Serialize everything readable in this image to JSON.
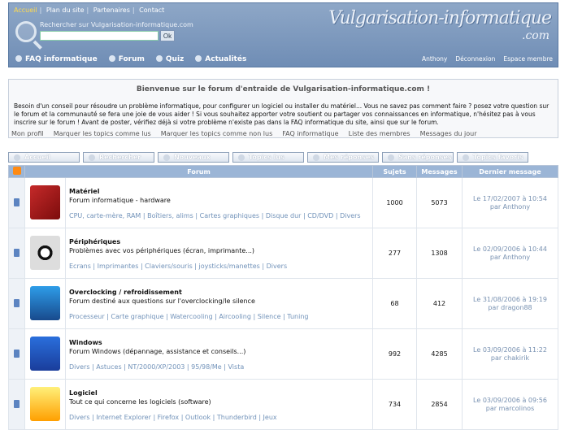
{
  "topnav": {
    "home": "Accueil",
    "sitemap": "Plan du site",
    "partners": "Partenaires",
    "contact": "Contact"
  },
  "search": {
    "label": "Rechercher sur Vulgarisation-informatique.com",
    "value": "",
    "button": "Ok"
  },
  "logo": {
    "main": "Vulgarisation-informatique",
    ".com": ".com"
  },
  "header_nav": [
    "FAQ informatique",
    "Forum",
    "Quiz",
    "Actualités"
  ],
  "user_nav": [
    "Anthony",
    "Déconnexion",
    "Espace membre"
  ],
  "welcome": {
    "title": "Bienvenue sur le forum d'entraide de Vulgarisation-informatique.com !",
    "text": "Besoin d'un conseil pour résoudre un problème informatique, pour configurer un logiciel ou installer du matériel... Vous ne savez pas comment faire ? posez votre question sur le forum et la communauté se fera une joie de vous aider ! Si vous souhaitez apporter votre soutient ou partager vos connaissances en informatique, n'hésitez pas à vous inscrire sur le forum ! Avant de poster, vérifiez déjà si votre problème n'existe pas dans la FAQ informatique du site, ainsi que sur le forum."
  },
  "menu": [
    "Mon profil",
    "Marquer les topics comme lus",
    "Marquer les topics comme non lus",
    "FAQ informatique",
    "Liste des membres",
    "Messages du jour"
  ],
  "tabs": [
    "Accueil",
    "Rechercher",
    "Nouveaux",
    "Topics lus",
    "Mes réponses",
    "Sans réponses",
    "Topics favoris"
  ],
  "table": {
    "headers": [
      "Forum",
      "Sujets",
      "Messages",
      "Dernier message"
    ],
    "rows": [
      {
        "title": "Matériel",
        "desc": "Forum informatique - hardware",
        "subs": "CPU, carte-mère, RAM | Boîtiers, alims | Cartes graphiques | Disque dur | CD/DVD | Divers",
        "topics": "1000",
        "messages": "5073",
        "last_date": "Le 17/02/2007 à 10:54",
        "last_user": "par Anthony"
      },
      {
        "title": "Périphériques",
        "desc": "Problèmes avec vos périphériques (écran, imprimante...)",
        "subs": "Ecrans | Imprimantes | Claviers/souris | joysticks/manettes | Divers",
        "topics": "277",
        "messages": "1308",
        "last_date": "Le 02/09/2006 à 10:44",
        "last_user": "par Anthony"
      },
      {
        "title": "Overclocking / refroidissement",
        "desc": "Forum destiné aux questions sur l'overclocking/le silence",
        "subs": "Processeur | Carte graphique | Watercooling | Aircooling | Silence | Tuning",
        "topics": "68",
        "messages": "412",
        "last_date": "Le 31/08/2006 à 19:19",
        "last_user": "par dragon88"
      },
      {
        "title": "Windows",
        "desc": "Forum Windows (dépannage, assistance et conseils...)",
        "subs": "Divers | Astuces | NT/2000/XP/2003 | 95/98/Me | Vista",
        "topics": "992",
        "messages": "4285",
        "last_date": "Le 03/09/2006 à 11:22",
        "last_user": "par chakirik"
      },
      {
        "title": "Logiciel",
        "desc": "Tout ce qui concerne les logiciels (software)",
        "subs": "Divers | Internet Explorer | Firefox | Outlook | Thunderbird | Jeux",
        "topics": "734",
        "messages": "2854",
        "last_date": "Le 03/09/2006 à 09:56",
        "last_user": "par marcolinos"
      }
    ]
  }
}
